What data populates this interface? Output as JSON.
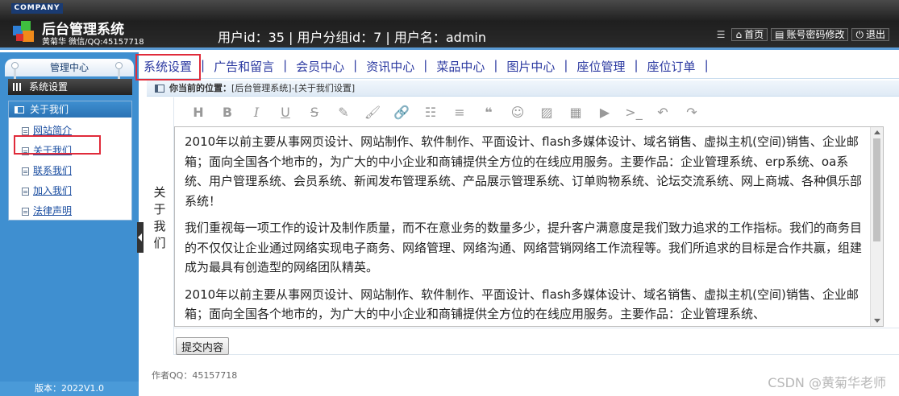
{
  "header": {
    "company": "COMPANY",
    "title": "后台管理系统",
    "subtitle": "黄菊华 微信/QQ:45157718",
    "user_info": "用户id：35 | 用户分组id：7 | 用户名：admin",
    "links": [
      "首页",
      "账号密码修改",
      "退出"
    ]
  },
  "sidebar": {
    "tab": "管理中心",
    "section": "系统设置",
    "group": "关于我们",
    "items": [
      "网站简介",
      "关于我们",
      "联系我们",
      "加入我们",
      "法律声明"
    ],
    "version": "版本：2022V1.0"
  },
  "nav": {
    "items": [
      "系统设置",
      "广告和留言",
      "会员中心",
      "资讯中心",
      "菜品中心",
      "图片中心",
      "座位管理",
      "座位订单"
    ]
  },
  "breadcrumb": {
    "label": "你当前的位置：",
    "path": "[后台管理系统]-[关于我们设置]"
  },
  "form": {
    "field_label": "关于我们",
    "paragraphs": [
      "2010年以前主要从事网页设计、网站制作、软件制作、平面设计、flash多媒体设计、域名销售、虚拟主机(空间)销售、企业邮箱；面向全国各个地市的，为广大的中小企业和商铺提供全方位的在线应用服务。主要作品：企业管理系统、erp系统、oa系统、用户管理系统、会员系统、新闻发布管理系统、产品展示管理系统、订单购物系统、论坛交流系统、网上商城、各种俱乐部系统！",
      "我们重视每一项工作的设计及制作质量，而不在意业务的数量多少，提升客户满意度是我们致力追求的工作指标。我们的商务目的不仅仅让企业通过网络实现电子商务、网络管理、网络沟通、网络营销网络工作流程等。我们所追求的目标是合作共赢，组建成为最具有创造型的网络团队精英。",
      "2010年以前主要从事网页设计、网站制作、软件制作、平面设计、flash多媒体设计、域名销售、虚拟主机(空间)销售、企业邮箱；面向全国各个地市的，为广大的中小企业和商铺提供全方位的在线应用服务。主要作品：企业管理系统、"
    ],
    "submit_label": "提交内容"
  },
  "footer": {
    "author": "作者QQ：45157718",
    "watermark": "CSDN @黄菊华老师"
  },
  "colors": {
    "accent": "#3f8fd0",
    "nav_text": "#2a38a0",
    "highlight": "#e02b3a"
  }
}
